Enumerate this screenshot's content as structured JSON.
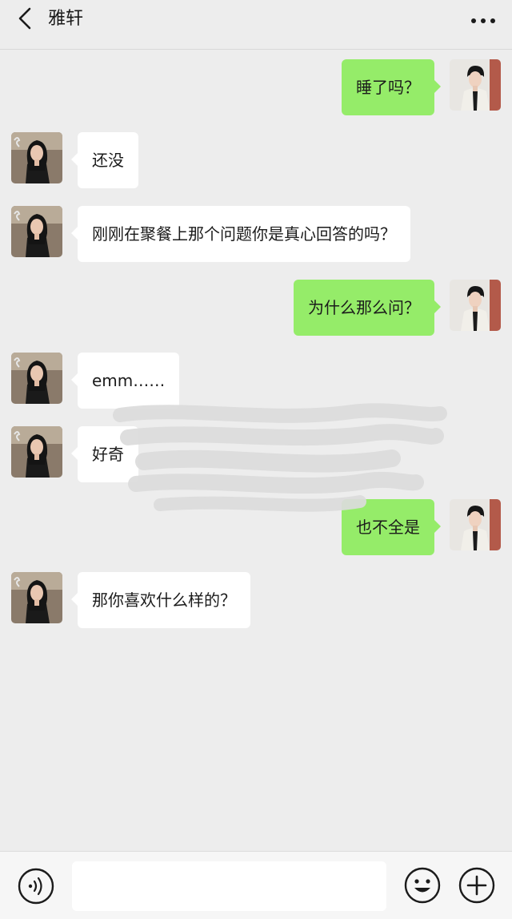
{
  "header": {
    "title": "雅轩",
    "back_icon": "chevron-left-icon",
    "more_icon": "more-dots-icon"
  },
  "messages": [
    {
      "side": "out",
      "text": "睡了吗？"
    },
    {
      "side": "in",
      "text": "还没"
    },
    {
      "side": "in",
      "text": "刚刚在聚餐上那个问题你是真心回答的吗？"
    },
    {
      "side": "out",
      "text": "为什么那么问？"
    },
    {
      "side": "in",
      "text": "emm……"
    },
    {
      "side": "in",
      "text": "好奇"
    },
    {
      "side": "out",
      "text": "也不全是"
    },
    {
      "side": "in",
      "text": "那你喜欢什么样的？"
    }
  ],
  "input_bar": {
    "placeholder": "",
    "voice_icon": "voice-icon",
    "emoji_icon": "emoji-icon",
    "plus_icon": "plus-icon"
  },
  "colors": {
    "background": "#ededed",
    "outgoing_bubble": "#95ec69",
    "incoming_bubble": "#ffffff"
  }
}
